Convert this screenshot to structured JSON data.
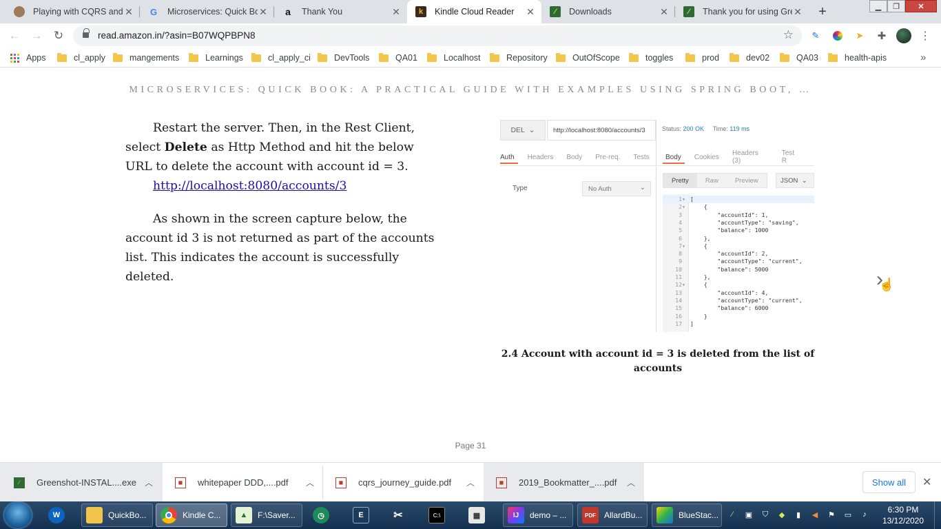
{
  "browser": {
    "tabs": [
      {
        "title": "Playing with CQRS and E",
        "icon": "person-photo-icon"
      },
      {
        "title": "Microservices: Quick Boo",
        "icon": "google-icon"
      },
      {
        "title": "Thank You",
        "icon": "amazon-icon"
      },
      {
        "title": "Kindle Cloud Reader",
        "icon": "kindle-icon",
        "active": true
      },
      {
        "title": "Downloads",
        "icon": "greenshot-icon"
      },
      {
        "title": "Thank you for using Gree",
        "icon": "greenshot-icon"
      }
    ],
    "url": "read.amazon.in/?asin=B07WQPBPN8",
    "bookmarks": [
      "Apps",
      "cl_apply",
      "mangements",
      "Learnings",
      "cl_apply_ci",
      "DevTools",
      "QA01",
      "Localhost",
      "Repository",
      "OutOfScope",
      "toggles",
      "prod",
      "dev02",
      "QA03",
      "health-apis"
    ]
  },
  "reader": {
    "book_title": "MICROSERVICES: QUICK BOOK: A PRACTICAL GUIDE WITH EXAMPLES USING SPRING BOOT, …",
    "para1_a": "Restart the server. Then, in the Rest Client, select ",
    "para1_bold": "Delete",
    "para1_b": " as Http Method and hit the below URL to delete the account with account id = 3.",
    "link": "http://localhost:8080/accounts/3",
    "para2": "As shown in the screen capture below, the account id 3 is not returned as part of the accounts list. This indicates the account is successfully deleted.",
    "caption": "2.4 Account with account id = 3 is deleted from the list of accounts",
    "page": "Page 31"
  },
  "screenshot": {
    "method": "DEL",
    "url": "http://localhost:8080/accounts/3",
    "status_label": "Status:",
    "status_value": "200 OK",
    "time_label": "Time:",
    "time_value": "119 ms",
    "left_tabs": [
      "Auth",
      "Headers",
      "Body",
      "Pre-req.",
      "Tests"
    ],
    "right_tabs": [
      "Body",
      "Cookies",
      "Headers (3)",
      "Test R"
    ],
    "type_label": "Type",
    "auth_value": "No Auth",
    "format_tabs": [
      "Pretty",
      "Raw",
      "Preview"
    ],
    "format": "JSON",
    "code_lines": [
      {
        "n": "1",
        "f": "▾",
        "t": "["
      },
      {
        "n": "2",
        "f": "▾",
        "t": "    {"
      },
      {
        "n": "3",
        "f": "",
        "t": "        \"accountId\": 1,"
      },
      {
        "n": "4",
        "f": "",
        "t": "        \"accountType\": \"saving\","
      },
      {
        "n": "5",
        "f": "",
        "t": "        \"balance\": 1000"
      },
      {
        "n": "6",
        "f": "",
        "t": "    },"
      },
      {
        "n": "7",
        "f": "▾",
        "t": "    {"
      },
      {
        "n": "8",
        "f": "",
        "t": "        \"accountId\": 2,"
      },
      {
        "n": "9",
        "f": "",
        "t": "        \"accountType\": \"current\","
      },
      {
        "n": "10",
        "f": "",
        "t": "        \"balance\": 5000"
      },
      {
        "n": "11",
        "f": "",
        "t": "    },"
      },
      {
        "n": "12",
        "f": "▾",
        "t": "    {"
      },
      {
        "n": "13",
        "f": "",
        "t": "        \"accountId\": 4,"
      },
      {
        "n": "14",
        "f": "",
        "t": "        \"accountType\": \"current\","
      },
      {
        "n": "15",
        "f": "",
        "t": "        \"balance\": 6000"
      },
      {
        "n": "16",
        "f": "",
        "t": "    }"
      },
      {
        "n": "17",
        "f": "",
        "t": "]"
      }
    ]
  },
  "downloads": {
    "items": [
      "Greenshot-INSTAL....exe",
      "whitepaper DDD,....pdf",
      "cqrs_journey_guide.pdf",
      "2019_Bookmatter_....pdf"
    ],
    "show_all": "Show all"
  },
  "taskbar": {
    "items": [
      "QuickBo...",
      "Kindle C...",
      "F:\\Saver...",
      "demo – ...",
      "AllardBu...",
      "BlueStac..."
    ],
    "time": "6:30 PM",
    "date": "13/12/2020"
  }
}
